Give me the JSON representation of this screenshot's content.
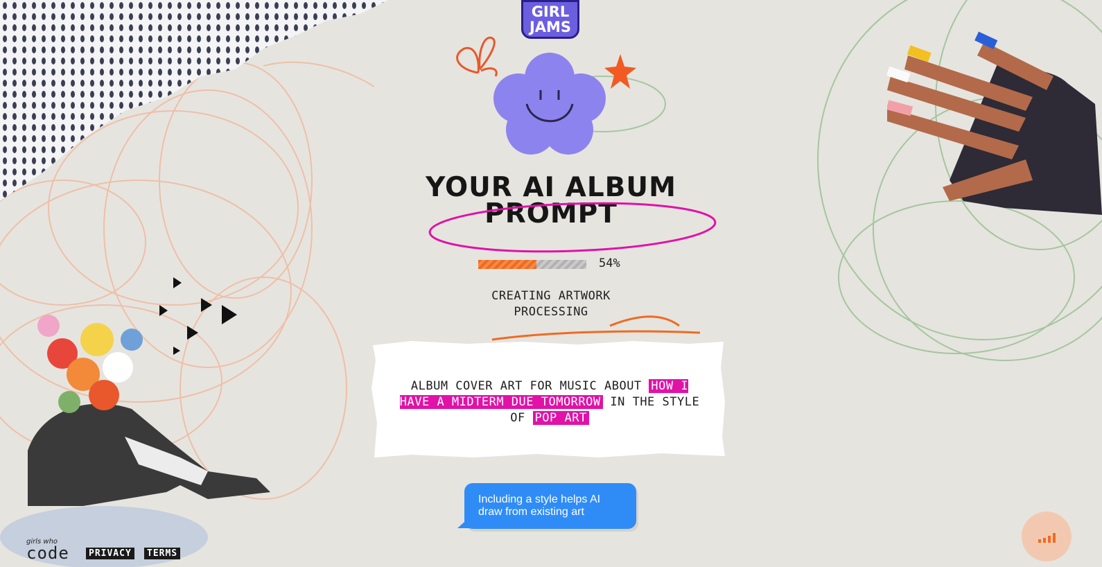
{
  "logo": {
    "line1": "GIRL",
    "line2": "JAMS"
  },
  "title": {
    "line1": "YOUR AI ALBUM",
    "line2": "PROMPT"
  },
  "progress": {
    "percent": 54,
    "label": "54%"
  },
  "status": {
    "line1": "CREATING ARTWORK",
    "line2": "PROCESSING"
  },
  "prompt": {
    "prefix": "ALBUM COVER ART FOR MUSIC ABOUT",
    "topic": "HOW I HAVE A MIDTERM DUE TOMORROW",
    "middle": "IN THE STYLE OF",
    "style": "POP ART"
  },
  "tip": {
    "text": "Including a style helps AI draw from existing art"
  },
  "footer": {
    "brand_small": "girls who",
    "brand_big": "code",
    "privacy": "PRIVACY",
    "terms": "TERMS"
  },
  "colors": {
    "background": "#e6e4df",
    "accent_pink": "#e012a8",
    "accent_orange": "#f06a22",
    "accent_purple": "#8d83ee",
    "bubble_blue": "#2f8cf7"
  },
  "icons": {
    "sound": "sound-bars-icon",
    "flower": "smiley-flower-icon",
    "star": "star-icon"
  }
}
